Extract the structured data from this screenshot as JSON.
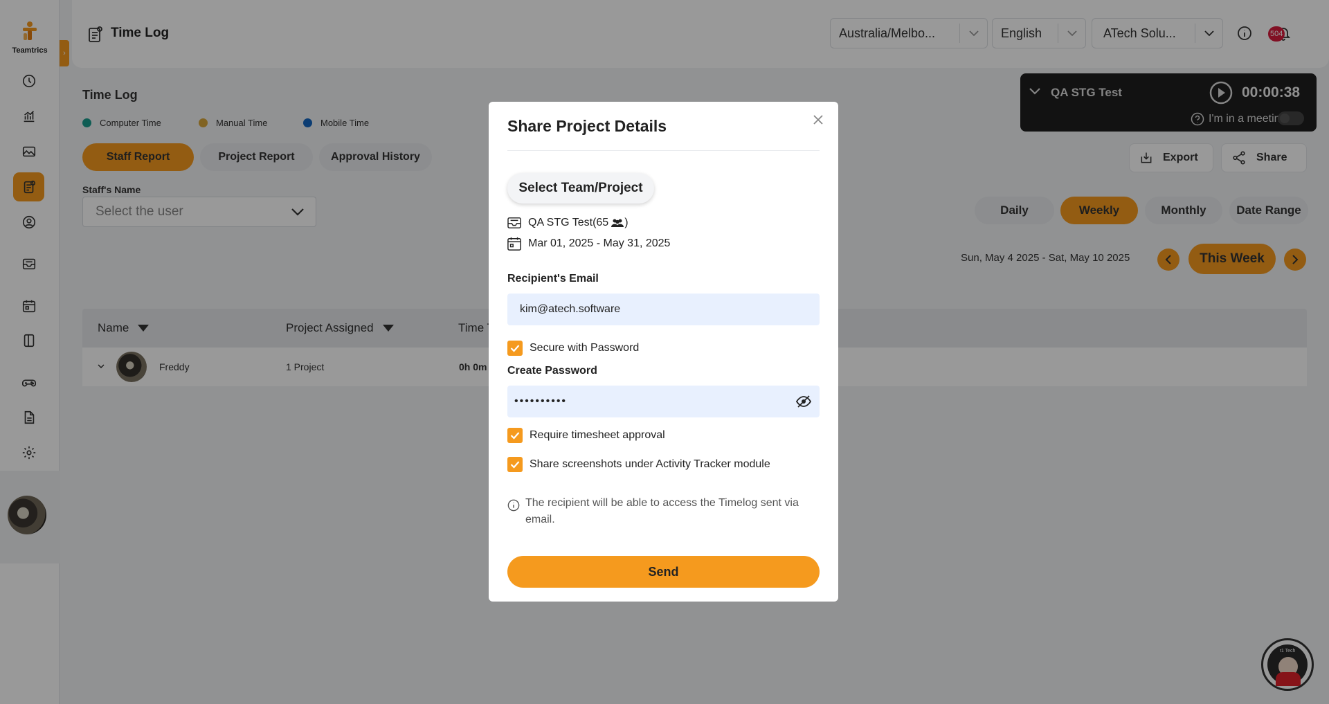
{
  "app": {
    "brand": "Teamtrics",
    "page_title": "Time Log",
    "colors": {
      "accent": "#f59a1e",
      "badge": "#d81b3c",
      "computer": "#1a9b8d",
      "manual": "#d8a53a",
      "mobile": "#1566c0"
    }
  },
  "header": {
    "timezone": "Australia/Melbo...",
    "language": "English",
    "company": "ATech Solu...",
    "notification_count": "504"
  },
  "timer": {
    "project": "QA STG Test",
    "time": "00:00:38",
    "meeting_label": "I'm in a meeting"
  },
  "main": {
    "section_title": "Time Log",
    "legend": [
      "Computer Time",
      "Manual Time",
      "Mobile Time"
    ],
    "tabs": [
      "Staff Report",
      "Project Report",
      "Approval History"
    ],
    "actions": {
      "export": "Export",
      "share": "Share"
    },
    "staff_label": "Staff's Name",
    "staff_placeholder": "Select the user",
    "ranges": [
      "Daily",
      "Weekly",
      "Monthly",
      "Date Range"
    ],
    "date_range": "Sun, May 4 2025 - Sat, May 10 2025",
    "this_week": "This Week",
    "table": {
      "columns": [
        "Name",
        "Project Assigned",
        "Time T"
      ],
      "rows": [
        {
          "name": "Freddy",
          "projects": "1 Project",
          "time": "0h 0m"
        }
      ]
    }
  },
  "modal": {
    "title": "Share Project Details",
    "select_button": "Select Team/Project",
    "project_name": "QA STG Test(65",
    "project_suffix": ")",
    "date_span": "Mar 01, 2025 - May 31, 2025",
    "email_label": "Recipient's Email",
    "email_value": "kim@atech.software",
    "secure_label": "Secure with Password",
    "password_label": "Create Password",
    "password_value": "••••••••••",
    "approval_label": "Require timesheet approval",
    "screenshots_label": "Share screenshots under Activity Tracker module",
    "note": "The recipient will be able to access the Timelog sent via email.",
    "send": "Send"
  },
  "chat": {
    "label": "r1 Tech"
  }
}
